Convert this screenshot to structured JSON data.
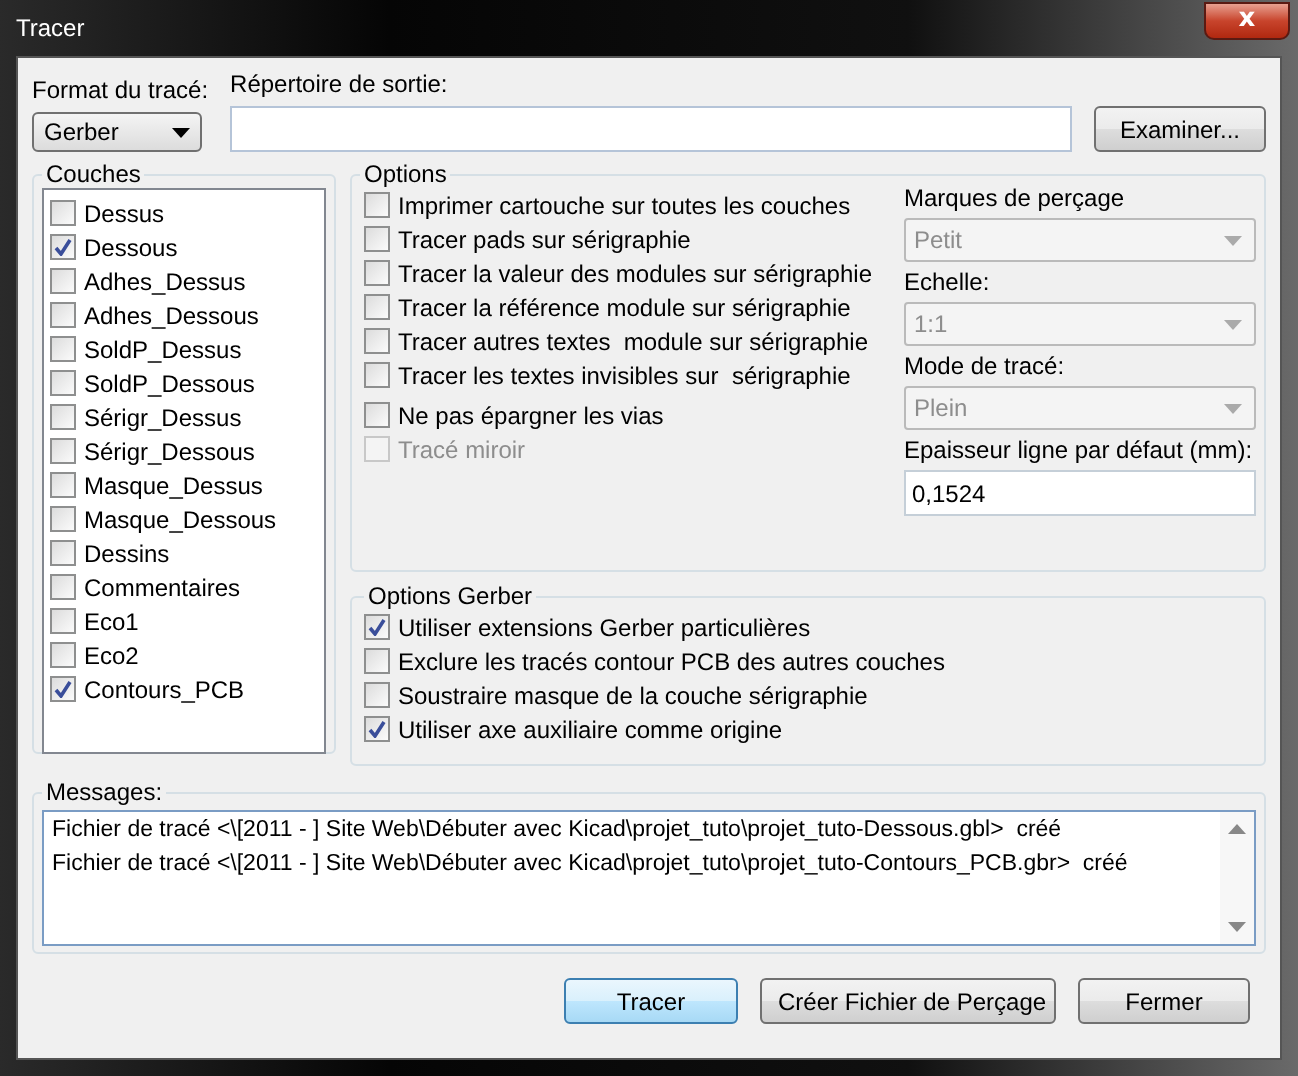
{
  "window": {
    "title": "Tracer",
    "close": "x"
  },
  "format": {
    "label": "Format du tracé:",
    "value": "Gerber"
  },
  "output": {
    "label": "Répertoire de sortie:",
    "button": "Examiner..."
  },
  "layers": {
    "title": "Couches",
    "items": [
      {
        "label": "Dessus",
        "checked": false
      },
      {
        "label": "Dessous",
        "checked": true
      },
      {
        "label": "Adhes_Dessus",
        "checked": false
      },
      {
        "label": "Adhes_Dessous",
        "checked": false
      },
      {
        "label": "SoldP_Dessus",
        "checked": false
      },
      {
        "label": "SoldP_Dessous",
        "checked": false
      },
      {
        "label": "Sérigr_Dessus",
        "checked": false
      },
      {
        "label": "Sérigr_Dessous",
        "checked": false
      },
      {
        "label": "Masque_Dessus",
        "checked": false
      },
      {
        "label": "Masque_Dessous",
        "checked": false
      },
      {
        "label": "Dessins",
        "checked": false
      },
      {
        "label": "Commentaires",
        "checked": false
      },
      {
        "label": "Eco1",
        "checked": false
      },
      {
        "label": "Eco2",
        "checked": false
      },
      {
        "label": "Contours_PCB",
        "checked": true
      }
    ]
  },
  "options": {
    "title": "Options",
    "checks": [
      {
        "label": "Imprimer cartouche sur toutes les couches",
        "checked": false,
        "disabled": false
      },
      {
        "label": "Tracer pads sur sérigraphie",
        "checked": false,
        "disabled": false
      },
      {
        "label": "Tracer la valeur des modules sur sérigraphie",
        "checked": false,
        "disabled": false
      },
      {
        "label": "Tracer la référence module sur sérigraphie",
        "checked": false,
        "disabled": false
      },
      {
        "label": "Tracer autres textes  module sur sérigraphie",
        "checked": false,
        "disabled": false
      },
      {
        "label": "Tracer les textes invisibles sur  sérigraphie",
        "checked": false,
        "disabled": false
      },
      {
        "label": "Ne pas épargner les vias",
        "checked": false,
        "disabled": false
      },
      {
        "label": "Tracé miroir",
        "checked": false,
        "disabled": true
      }
    ],
    "fields": [
      {
        "kind": "dropdown",
        "label": "Marques de perçage",
        "value": "Petit",
        "disabled": true
      },
      {
        "kind": "dropdown",
        "label": "Echelle:",
        "value": "1:1",
        "disabled": true
      },
      {
        "kind": "dropdown",
        "label": "Mode de tracé:",
        "value": "Plein",
        "disabled": true
      },
      {
        "kind": "input",
        "label": "Epaisseur ligne par défaut (mm):",
        "value": "0,1524",
        "disabled": false
      }
    ]
  },
  "gerber": {
    "title": "Options Gerber",
    "checks": [
      {
        "label": "Utiliser extensions Gerber particulières",
        "checked": true
      },
      {
        "label": "Exclure les tracés contour PCB des autres couches",
        "checked": false
      },
      {
        "label": "Soustraire masque de la couche sérigraphie",
        "checked": false
      },
      {
        "label": "Utiliser axe auxiliaire comme origine",
        "checked": true
      }
    ]
  },
  "messages": {
    "title": "Messages:",
    "lines": [
      "Fichier de tracé <\\[2011 - ] Site Web\\Débuter avec Kicad\\projet_tuto\\projet_tuto-Dessous.gbl>  créé",
      "Fichier de tracé <\\[2011 - ] Site Web\\Débuter avec Kicad\\projet_tuto\\projet_tuto-Contours_PCB.gbr>  créé"
    ]
  },
  "buttons": [
    {
      "label": "Tracer",
      "selected": true
    },
    {
      "label": "Créer Fichier de Perçage",
      "selected": false
    },
    {
      "label": "Fermer",
      "selected": false
    }
  ]
}
